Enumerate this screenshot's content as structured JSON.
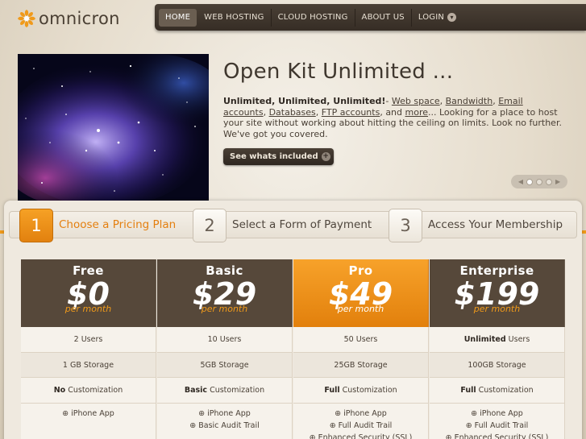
{
  "brand": {
    "name": "omnicron",
    "logo_icon": "flower-icon",
    "accent": "#f09a1a",
    "dark": "#4a4036"
  },
  "nav": {
    "items": [
      {
        "label": "HOME",
        "active": true
      },
      {
        "label": "WEB HOSTING"
      },
      {
        "label": "CLOUD HOSTING"
      },
      {
        "label": "ABOUT US"
      },
      {
        "label": "LOGIN",
        "icon": "chevron-down-icon"
      }
    ]
  },
  "hero": {
    "title": "Open Kit Unlimited ...",
    "lead_bold": "Unlimited, Unlimited, Unlimited!",
    "dash": "- ",
    "links": [
      "Web space",
      "Bandwidth",
      "Email accounts",
      "Databases",
      "FTP accounts",
      "more"
    ],
    "sep": ", ",
    "and": ", and ",
    "tail": "... Looking for a place to host your site without working about hitting the ceiling on limits. Look no further. We've got you covered.",
    "button_label": "See whats included",
    "button_icon": "plus-icon",
    "slider": {
      "slides": 3,
      "active": 1
    }
  },
  "steps": [
    {
      "num": "1",
      "label": "Choose a Pricing Plan",
      "active": true
    },
    {
      "num": "2",
      "label": "Select a Form of Payment"
    },
    {
      "num": "3",
      "label": "Access Your Membership"
    }
  ],
  "pricing": {
    "plans": [
      {
        "name": "Free",
        "price": "$0",
        "per": "per month",
        "users": {
          "strong": "",
          "value": "2 Users"
        },
        "storage": {
          "strong": "",
          "value": "1 GB Storage"
        },
        "custom": {
          "strong": "No",
          "value": " Customization"
        },
        "features": [
          "⊕ iPhone App"
        ]
      },
      {
        "name": "Basic",
        "price": "$29",
        "per": "per month",
        "users": {
          "strong": "",
          "value": "10 Users"
        },
        "storage": {
          "strong": "",
          "value": "5GB Storage"
        },
        "custom": {
          "strong": "Basic",
          "value": " Customization"
        },
        "features": [
          "⊕ iPhone App",
          "⊕ Basic Audit Trail"
        ]
      },
      {
        "name": "Pro",
        "price": "$49",
        "per": "per month",
        "highlight": true,
        "users": {
          "strong": "",
          "value": "50 Users"
        },
        "storage": {
          "strong": "",
          "value": "25GB Storage"
        },
        "custom": {
          "strong": "Full",
          "value": " Customization"
        },
        "features": [
          "⊕ iPhone App",
          "⊕ Full Audit Trail",
          "⊕ Enhanced Security (SSL)"
        ]
      },
      {
        "name": "Enterprise",
        "price": "$199",
        "per": "per month",
        "users": {
          "strong": "Unlimited",
          "value": " Users"
        },
        "storage": {
          "strong": "",
          "value": "100GB Storage"
        },
        "custom": {
          "strong": "Full",
          "value": " Customization"
        },
        "features": [
          "⊕ iPhone App",
          "⊕ Full Audit Trail",
          "⊕ Enhanced Security (SSL)"
        ]
      }
    ]
  }
}
